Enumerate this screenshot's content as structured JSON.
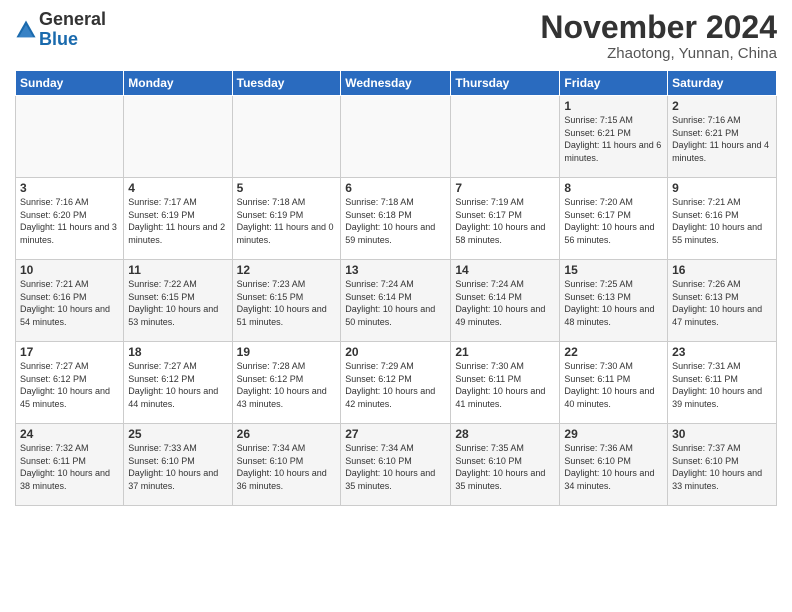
{
  "header": {
    "logo_general": "General",
    "logo_blue": "Blue",
    "month_title": "November 2024",
    "location": "Zhaotong, Yunnan, China"
  },
  "weekdays": [
    "Sunday",
    "Monday",
    "Tuesday",
    "Wednesday",
    "Thursday",
    "Friday",
    "Saturday"
  ],
  "weeks": [
    [
      {
        "day": "",
        "info": ""
      },
      {
        "day": "",
        "info": ""
      },
      {
        "day": "",
        "info": ""
      },
      {
        "day": "",
        "info": ""
      },
      {
        "day": "",
        "info": ""
      },
      {
        "day": "1",
        "info": "Sunrise: 7:15 AM\nSunset: 6:21 PM\nDaylight: 11 hours and 6 minutes."
      },
      {
        "day": "2",
        "info": "Sunrise: 7:16 AM\nSunset: 6:21 PM\nDaylight: 11 hours and 4 minutes."
      }
    ],
    [
      {
        "day": "3",
        "info": "Sunrise: 7:16 AM\nSunset: 6:20 PM\nDaylight: 11 hours and 3 minutes."
      },
      {
        "day": "4",
        "info": "Sunrise: 7:17 AM\nSunset: 6:19 PM\nDaylight: 11 hours and 2 minutes."
      },
      {
        "day": "5",
        "info": "Sunrise: 7:18 AM\nSunset: 6:19 PM\nDaylight: 11 hours and 0 minutes."
      },
      {
        "day": "6",
        "info": "Sunrise: 7:18 AM\nSunset: 6:18 PM\nDaylight: 10 hours and 59 minutes."
      },
      {
        "day": "7",
        "info": "Sunrise: 7:19 AM\nSunset: 6:17 PM\nDaylight: 10 hours and 58 minutes."
      },
      {
        "day": "8",
        "info": "Sunrise: 7:20 AM\nSunset: 6:17 PM\nDaylight: 10 hours and 56 minutes."
      },
      {
        "day": "9",
        "info": "Sunrise: 7:21 AM\nSunset: 6:16 PM\nDaylight: 10 hours and 55 minutes."
      }
    ],
    [
      {
        "day": "10",
        "info": "Sunrise: 7:21 AM\nSunset: 6:16 PM\nDaylight: 10 hours and 54 minutes."
      },
      {
        "day": "11",
        "info": "Sunrise: 7:22 AM\nSunset: 6:15 PM\nDaylight: 10 hours and 53 minutes."
      },
      {
        "day": "12",
        "info": "Sunrise: 7:23 AM\nSunset: 6:15 PM\nDaylight: 10 hours and 51 minutes."
      },
      {
        "day": "13",
        "info": "Sunrise: 7:24 AM\nSunset: 6:14 PM\nDaylight: 10 hours and 50 minutes."
      },
      {
        "day": "14",
        "info": "Sunrise: 7:24 AM\nSunset: 6:14 PM\nDaylight: 10 hours and 49 minutes."
      },
      {
        "day": "15",
        "info": "Sunrise: 7:25 AM\nSunset: 6:13 PM\nDaylight: 10 hours and 48 minutes."
      },
      {
        "day": "16",
        "info": "Sunrise: 7:26 AM\nSunset: 6:13 PM\nDaylight: 10 hours and 47 minutes."
      }
    ],
    [
      {
        "day": "17",
        "info": "Sunrise: 7:27 AM\nSunset: 6:12 PM\nDaylight: 10 hours and 45 minutes."
      },
      {
        "day": "18",
        "info": "Sunrise: 7:27 AM\nSunset: 6:12 PM\nDaylight: 10 hours and 44 minutes."
      },
      {
        "day": "19",
        "info": "Sunrise: 7:28 AM\nSunset: 6:12 PM\nDaylight: 10 hours and 43 minutes."
      },
      {
        "day": "20",
        "info": "Sunrise: 7:29 AM\nSunset: 6:12 PM\nDaylight: 10 hours and 42 minutes."
      },
      {
        "day": "21",
        "info": "Sunrise: 7:30 AM\nSunset: 6:11 PM\nDaylight: 10 hours and 41 minutes."
      },
      {
        "day": "22",
        "info": "Sunrise: 7:30 AM\nSunset: 6:11 PM\nDaylight: 10 hours and 40 minutes."
      },
      {
        "day": "23",
        "info": "Sunrise: 7:31 AM\nSunset: 6:11 PM\nDaylight: 10 hours and 39 minutes."
      }
    ],
    [
      {
        "day": "24",
        "info": "Sunrise: 7:32 AM\nSunset: 6:11 PM\nDaylight: 10 hours and 38 minutes."
      },
      {
        "day": "25",
        "info": "Sunrise: 7:33 AM\nSunset: 6:10 PM\nDaylight: 10 hours and 37 minutes."
      },
      {
        "day": "26",
        "info": "Sunrise: 7:34 AM\nSunset: 6:10 PM\nDaylight: 10 hours and 36 minutes."
      },
      {
        "day": "27",
        "info": "Sunrise: 7:34 AM\nSunset: 6:10 PM\nDaylight: 10 hours and 35 minutes."
      },
      {
        "day": "28",
        "info": "Sunrise: 7:35 AM\nSunset: 6:10 PM\nDaylight: 10 hours and 35 minutes."
      },
      {
        "day": "29",
        "info": "Sunrise: 7:36 AM\nSunset: 6:10 PM\nDaylight: 10 hours and 34 minutes."
      },
      {
        "day": "30",
        "info": "Sunrise: 7:37 AM\nSunset: 6:10 PM\nDaylight: 10 hours and 33 minutes."
      }
    ]
  ]
}
